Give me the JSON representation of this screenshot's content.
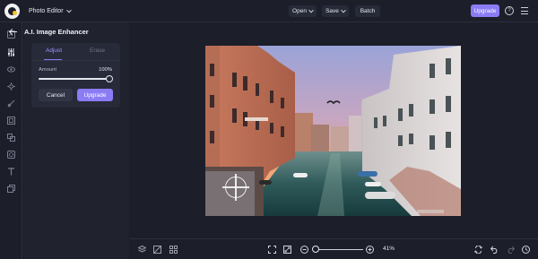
{
  "app": {
    "name": "Photo Editor"
  },
  "toolbar": {
    "open_label": "Open",
    "save_label": "Save",
    "batch_label": "Batch",
    "upgrade_label": "Upgrade"
  },
  "rail": {
    "icons": [
      "crop-icon",
      "adjust-icon",
      "eye-icon",
      "effects-icon",
      "touch-up-icon",
      "frames-icon",
      "overlays-icon",
      "graphics-icon",
      "text-icon",
      "textures-icon"
    ]
  },
  "panel": {
    "title": "A.I. Image Enhancer",
    "tabs": [
      "Adjust",
      "Erase"
    ],
    "active_tab": "Adjust",
    "amount_label": "Amount",
    "amount_value": "100%",
    "amount_fraction": 1.0,
    "cancel_label": "Cancel",
    "upgrade_label": "Upgrade"
  },
  "zoom": {
    "value": "41%",
    "fraction": 0.0
  },
  "colors": {
    "accent": "#8b7cf6",
    "background": "#1c1e29",
    "panel": "#20222e"
  }
}
